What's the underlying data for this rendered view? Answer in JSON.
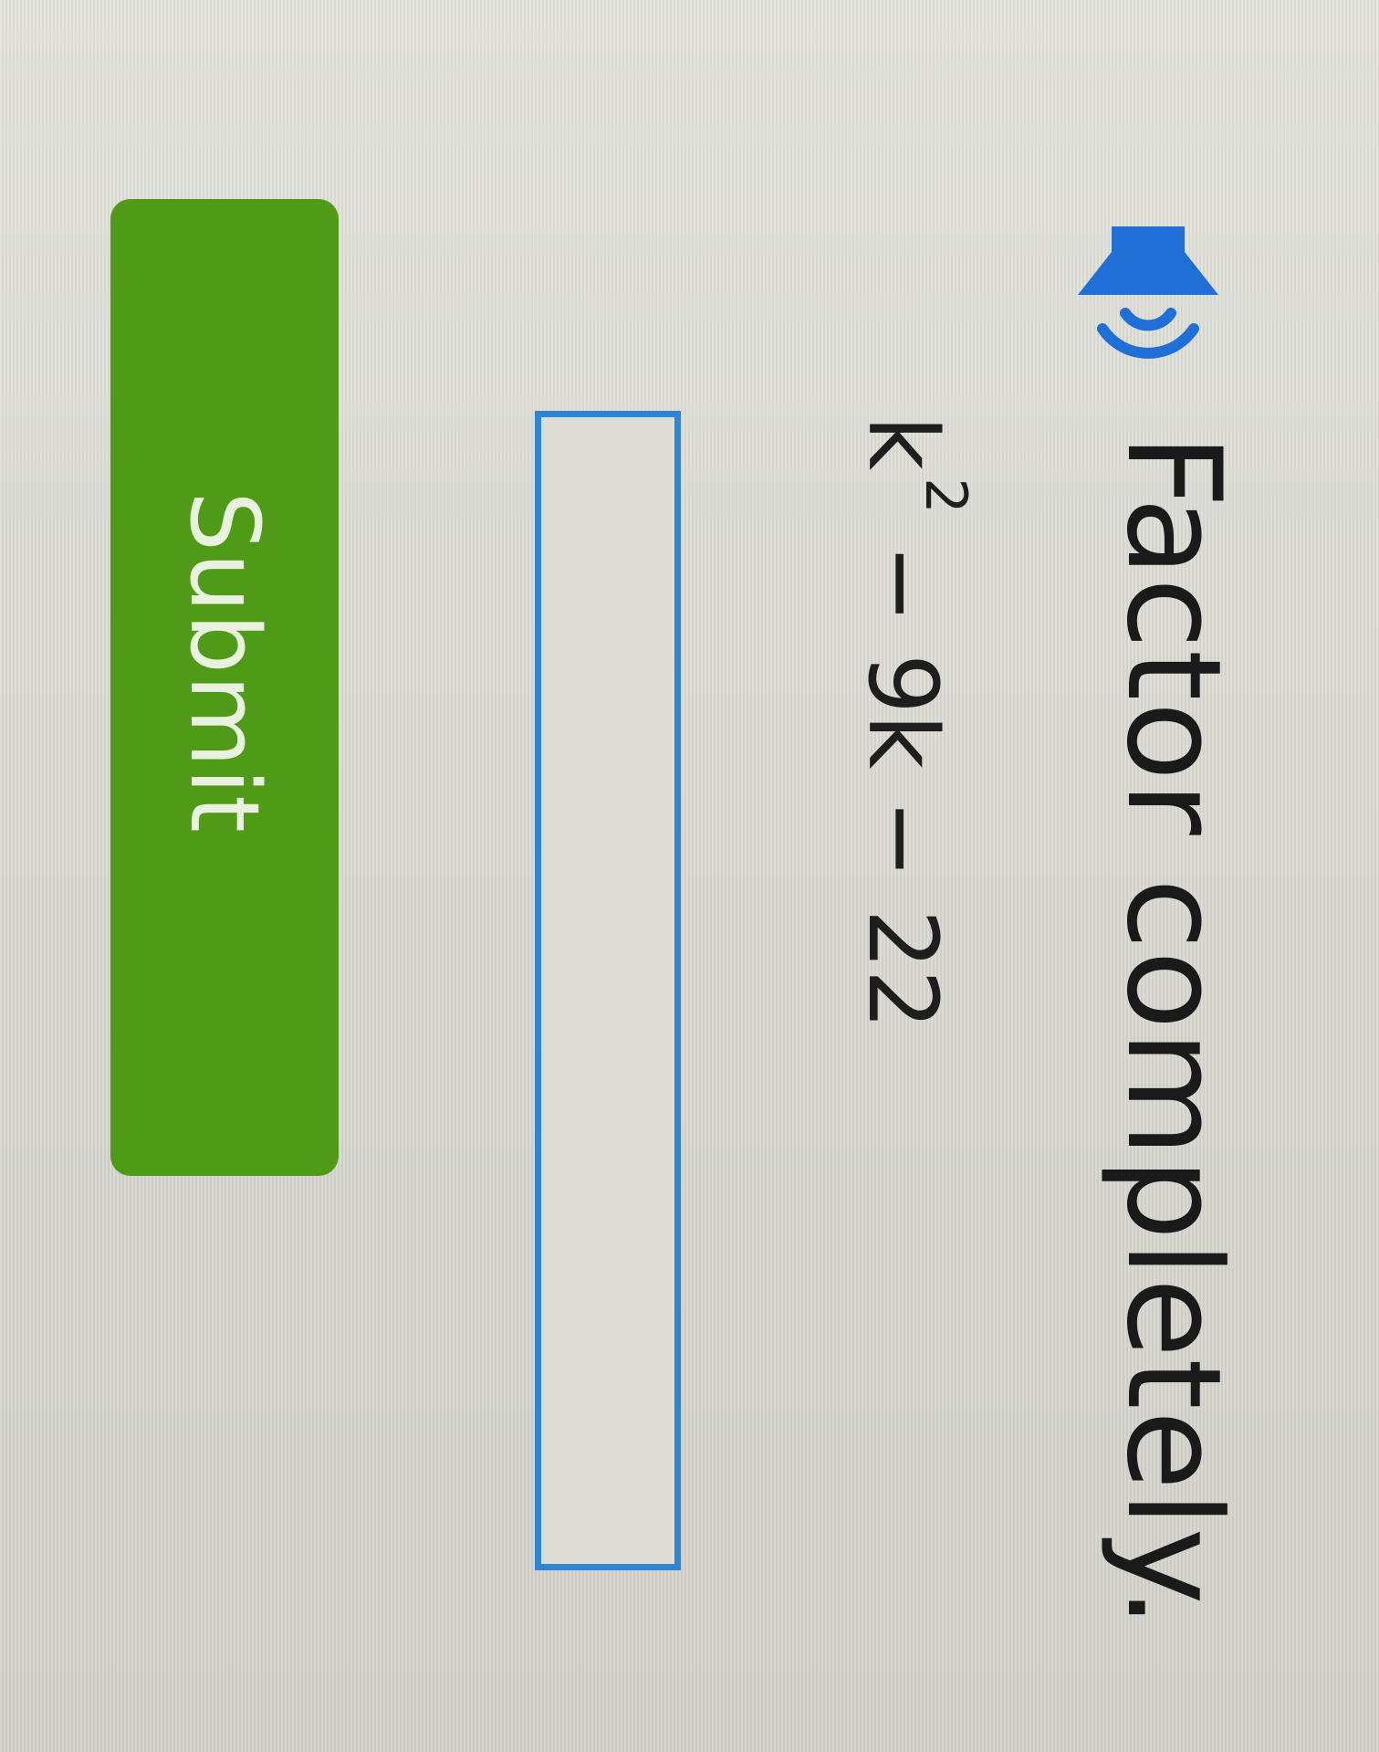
{
  "question": {
    "instruction": "Factor completely.",
    "expression_base": "k",
    "expression_exponent": "2",
    "expression_rest": " − 9k − 22"
  },
  "answer_field": {
    "value": ""
  },
  "submit": {
    "label": "Submit"
  },
  "colors": {
    "speaker_icon": "#1f6fd6",
    "submit_button": "#4f9a16",
    "input_border": "#2d86d4"
  }
}
